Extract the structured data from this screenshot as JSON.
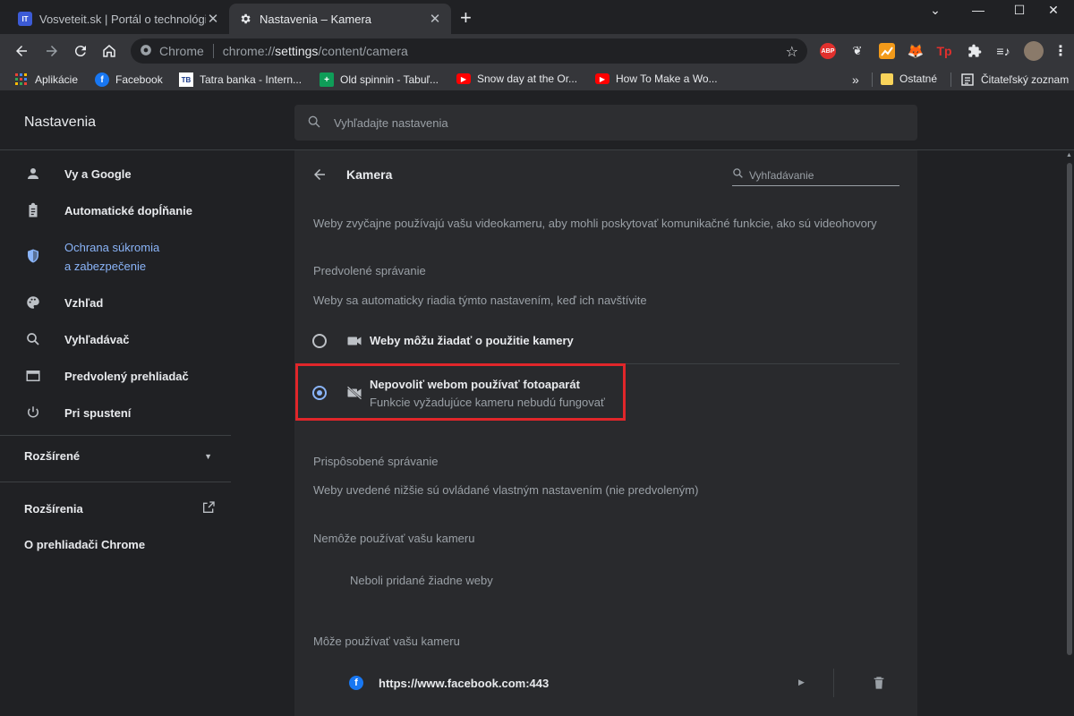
{
  "tabs": [
    {
      "title": "Vosveteit.sk | Portál o technológi",
      "favicon": "IT"
    },
    {
      "title": "Nastavenia – Kamera"
    }
  ],
  "omnibox": {
    "chip": "Chrome",
    "url_prefix": "chrome://",
    "url_bold": "settings",
    "url_suffix": "/content/camera"
  },
  "extensions": [
    "ABP",
    "Tp"
  ],
  "bookmarks": [
    {
      "label": "Aplikácie"
    },
    {
      "label": "Facebook"
    },
    {
      "label": "Tatra banka - Intern..."
    },
    {
      "label": "Old spinnin - Tabuľ..."
    },
    {
      "label": "Snow day at the Or..."
    },
    {
      "label": "How To Make a Wo..."
    }
  ],
  "bookmarks_overflow": "»",
  "bookmarks_right": {
    "other": "Ostatné",
    "reading": "Čitateľský zoznam"
  },
  "header": {
    "title": "Nastavenia",
    "search_placeholder": "Vyhľadajte nastavenia"
  },
  "sidebar": {
    "items": [
      {
        "label": "Vy a Google",
        "icon": "person-icon"
      },
      {
        "label": "Automatické dopĺňanie",
        "icon": "clipboard-icon"
      },
      {
        "label_line1": "Ochrana súkromia",
        "label_line2": "a zabezpečenie",
        "icon": "shield-icon",
        "active": true
      },
      {
        "label": "Vzhľad",
        "icon": "palette-icon"
      },
      {
        "label": "Vyhľadávač",
        "icon": "search-icon"
      },
      {
        "label": "Predvolený prehliadač",
        "icon": "browser-icon"
      },
      {
        "label": "Pri spustení",
        "icon": "power-icon"
      }
    ],
    "advanced": "Rozšírené",
    "extensions": "Rozšírenia",
    "about": "O prehliadači Chrome"
  },
  "page": {
    "title": "Kamera",
    "search_placeholder": "Vyhľadávanie",
    "description": "Weby zvyčajne používajú vašu videokameru, aby mohli poskytovať komunikačné funkcie, ako sú videohovory",
    "default_heading": "Predvolené správanie",
    "default_desc": "Weby sa automaticky riadia týmto nastavením, keď ich navštívite",
    "option_allow": "Weby môžu žiadať o použitie kamery",
    "option_block_title": "Nepovoliť webom používať fotoaparát",
    "option_block_sub": "Funkcie vyžadujúce kameru nebudú fungovať",
    "selected_option": "block",
    "custom_heading": "Prispôsobené správanie",
    "custom_desc": "Weby uvedené nižšie sú ovládané vlastným nastavením (nie predvoleným)",
    "blocked_heading": "Nemôže používať vašu kameru",
    "blocked_empty": "Neboli pridané žiadne weby",
    "allowed_heading": "Môže používať vašu kameru",
    "allowed_sites": [
      "https://www.facebook.com:443"
    ]
  },
  "colors": {
    "accent": "#8ab4f8",
    "highlight": "#e0262a",
    "background": "#202124",
    "card": "#292a2d"
  }
}
